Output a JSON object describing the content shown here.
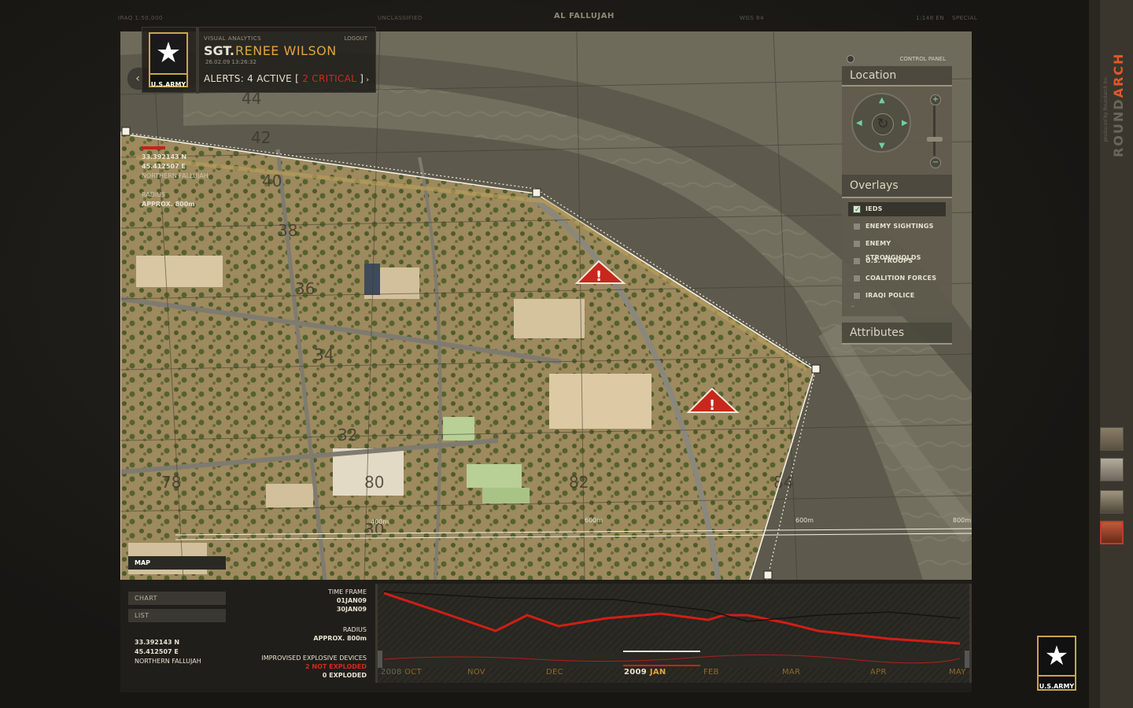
{
  "top_bar": {
    "left_scale": "IRAQ 1:50,000",
    "classification": "UNCLASSIFIED",
    "location_title": "AL FALLUJAH",
    "datum": "WGS 84",
    "right_info": "1:148 EN",
    "right_special": "SPECIAL"
  },
  "header": {
    "app_label": "VISUAL ANALYTICS",
    "logout_label": "LOGOUT",
    "rank": "SGT.",
    "user_name": "RENEE WILSON",
    "timestamp": "26.02.09 13:26:32",
    "alerts_prefix": "ALERTS: 4 ACTIVE [",
    "alerts_critical": " 2 CRITICAL ",
    "alerts_suffix": "]",
    "logo_text": "U.S.ARMY"
  },
  "map_info": {
    "lat": "33.392143 N",
    "lon": "45.412507 E",
    "place": "NORTHERN FALLUJAH",
    "radius_label": "RADIUS",
    "radius_value": "APPROX. 800m"
  },
  "grid_labels": [
    "44",
    "42",
    "40",
    "38",
    "36",
    "34",
    "32",
    "78",
    "80",
    "82",
    "84",
    "30"
  ],
  "scale_labels": [
    "400m",
    "600m",
    "600m",
    "800m"
  ],
  "control_panel": {
    "title": "CONTROL PANEL",
    "location_label": "Location",
    "overlays_label": "Overlays",
    "attributes_label": "Attributes",
    "overlays": [
      {
        "label": "IEDS",
        "checked": true
      },
      {
        "label": "ENEMY SIGHTINGS",
        "checked": false
      },
      {
        "label": "ENEMY STRONGHOLDS",
        "checked": false
      },
      {
        "label": "U.S. TROOPS",
        "checked": false
      },
      {
        "label": "COALITION FORCES",
        "checked": false
      },
      {
        "label": "IRAQI POLICE",
        "checked": false
      }
    ]
  },
  "tabs": {
    "map": "MAP",
    "chart": "CHART",
    "list": "LIST"
  },
  "bottom_info": {
    "time_frame_label": "TIME FRAME",
    "time_start": "01JAN09",
    "time_end": "30JAN09",
    "radius_label": "RADIUS",
    "radius_value": "APPROX. 800m",
    "ied_label": "IMPROVISED EXPLOSIVE DEVICES",
    "not_exploded": "2 NOT EXPLODED",
    "exploded": "0 EXPLODED",
    "lat": "33.392143 N",
    "lon": "45.412507 E",
    "place": "NORTHERN FALLUJAH"
  },
  "timeline": {
    "months": [
      {
        "year": "2008",
        "month": "OCT"
      },
      {
        "year": "",
        "month": "NOV"
      },
      {
        "year": "",
        "month": "DEC"
      },
      {
        "year": "2009",
        "month": "JAN"
      },
      {
        "year": "",
        "month": "FEB"
      },
      {
        "year": "",
        "month": "MAR"
      },
      {
        "year": "",
        "month": "APR"
      },
      {
        "year": "",
        "month": "MAY"
      }
    ],
    "current_index": 3
  },
  "sidebar": {
    "brand_1": "ROUND",
    "brand_2": "ARCH",
    "produced_by": "produced by Roundarch Inc.",
    "footer_logo_text": "U.S.ARMY"
  },
  "colors": {
    "accent_orange": "#e0a43c",
    "critical_red": "#d12a1c",
    "panel_bg": "#4a473c"
  }
}
